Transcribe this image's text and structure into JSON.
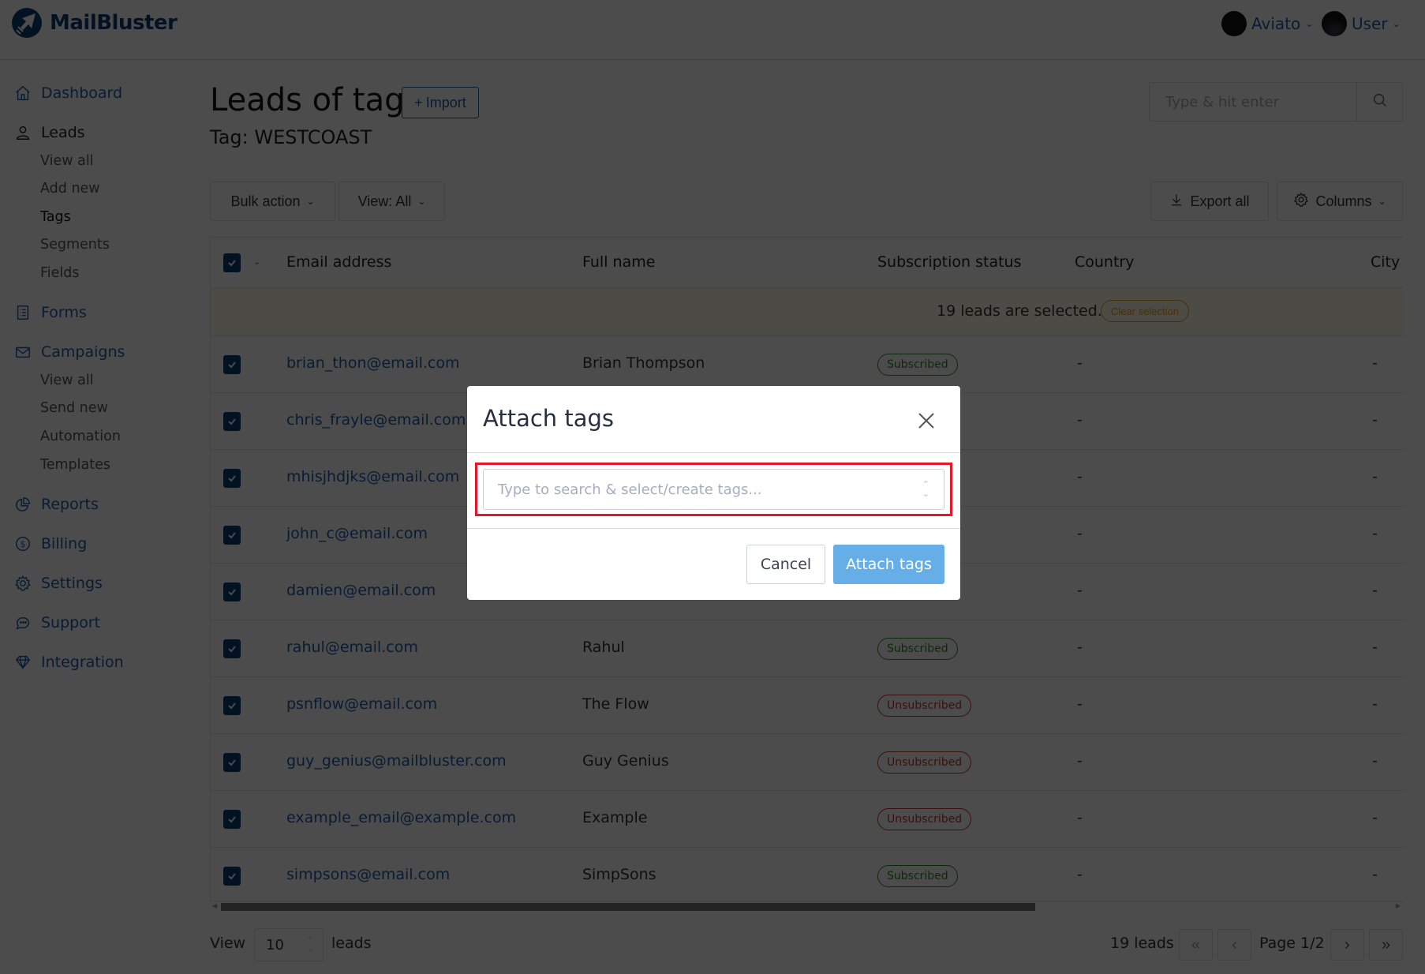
{
  "header": {
    "brand": "MailBluster",
    "account_label": "Aviato",
    "user_label": "User"
  },
  "sidebar": {
    "dashboard": "Dashboard",
    "leads": "Leads",
    "leads_sub": [
      "View all",
      "Add new",
      "Tags",
      "Segments",
      "Fields"
    ],
    "forms": "Forms",
    "campaigns": "Campaigns",
    "campaigns_sub": [
      "View all",
      "Send new",
      "Automation",
      "Templates"
    ],
    "reports": "Reports",
    "billing": "Billing",
    "settings": "Settings",
    "support": "Support",
    "integration": "Integration"
  },
  "main": {
    "title": "Leads of tag",
    "import_label": "Import",
    "tag_subtitle": "Tag: WESTCOAST",
    "search_placeholder": "Type & hit enter",
    "bulk_action_label": "Bulk action",
    "view_label": "View: All",
    "export_label": "Export all",
    "columns_label": "Columns"
  },
  "table": {
    "columns": [
      "Email address",
      "Full name",
      "Subscription status",
      "Country",
      "City"
    ],
    "selection_text": "19 leads are selected.",
    "clear_selection": "Clear selection",
    "rows": [
      {
        "email": "brian_thon@email.com",
        "name": "Brian Thompson",
        "status": "Subscribed",
        "country": "-",
        "city": "-"
      },
      {
        "email": "chris_frayle@email.com",
        "name": "",
        "status": "",
        "country": "-",
        "city": "-"
      },
      {
        "email": "mhisjhdjks@email.com",
        "name": "",
        "status": "",
        "country": "-",
        "city": "-"
      },
      {
        "email": "john_c@email.com",
        "name": "",
        "status": "",
        "country": "-",
        "city": "-"
      },
      {
        "email": "damien@email.com",
        "name": "",
        "status": "",
        "country": "-",
        "city": "-"
      },
      {
        "email": "rahul@email.com",
        "name": "Rahul",
        "status": "Subscribed",
        "country": "-",
        "city": "-"
      },
      {
        "email": "psnflow@email.com",
        "name": "The Flow",
        "status": "Unsubscribed",
        "country": "-",
        "city": "-"
      },
      {
        "email": "guy_genius@mailbluster.com",
        "name": "Guy Genius",
        "status": "Unsubscribed",
        "country": "-",
        "city": "-"
      },
      {
        "email": "example_email@example.com",
        "name": "Example",
        "status": "Unsubscribed",
        "country": "-",
        "city": "-"
      },
      {
        "email": "simpsons@email.com",
        "name": "SimpSons",
        "status": "Subscribed",
        "country": "-",
        "city": "-"
      }
    ]
  },
  "footer": {
    "view_label": "View",
    "per_page": "10",
    "leads_label": "leads",
    "total": "19 leads",
    "page": "Page 1/2"
  },
  "modal": {
    "title": "Attach tags",
    "tag_placeholder": "Type to search & select/create tags...",
    "cancel_label": "Cancel",
    "submit_label": "Attach tags"
  },
  "colors": {
    "brand": "#0b3d73",
    "link": "#1f5faa",
    "subscribed": "#2e8b2e",
    "unsubscribed": "#c0392b",
    "primary_button": "#66aee8",
    "highlight": "#e3192a"
  }
}
